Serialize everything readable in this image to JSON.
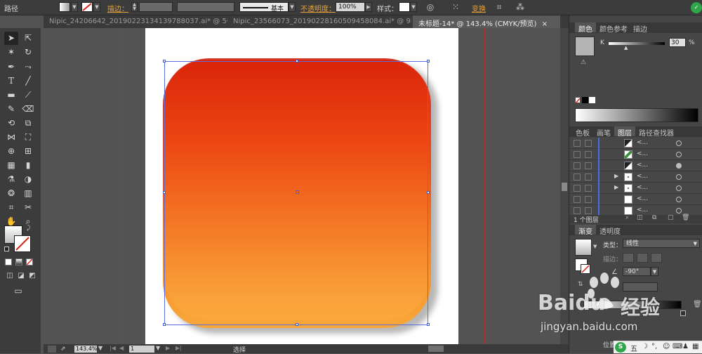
{
  "control_bar": {
    "object_type": "路径",
    "stroke_label": "描边：",
    "stroke_profile": "基本",
    "opacity_label": "不透明度：",
    "opacity_value": "100%",
    "style_label": "样式：",
    "transform_label": "变换",
    "accent_color": "#e8a13a"
  },
  "tabs": [
    {
      "label": "Nipic_24206642_20190223134139788037.ai* @ 50...",
      "active": false
    },
    {
      "label": "Nipic_23566073_20190228160509458084.ai* @ 98...",
      "active": false
    },
    {
      "label": "未标题-14* @ 143.4% (CMYK/预览)",
      "active": true
    }
  ],
  "status_bar": {
    "zoom": "143.4%",
    "artboard_number": "1",
    "tool_name": "选择"
  },
  "color_panel": {
    "tabs": [
      "颜色",
      "颜色参考",
      "描边"
    ],
    "channel_label": "K",
    "channel_value": "30",
    "percent_sign": "%"
  },
  "layers_panel": {
    "tabs": [
      "色板",
      "画笔",
      "图层",
      "路径查找器"
    ],
    "layer_item_label": "<...",
    "rows": [
      {
        "thumb": "diagonal",
        "expand": false,
        "targeted": false
      },
      {
        "thumb": "green",
        "expand": false,
        "targeted": false
      },
      {
        "thumb": "diagonal",
        "expand": false,
        "targeted": true
      },
      {
        "thumb": "dots",
        "expand": true,
        "targeted": false
      },
      {
        "thumb": "dots",
        "expand": true,
        "targeted": false
      },
      {
        "thumb": "white",
        "expand": false,
        "targeted": false
      },
      {
        "thumb": "white",
        "expand": false,
        "targeted": false
      }
    ],
    "footer_label": "1 个图层"
  },
  "gradient_panel": {
    "tabs": [
      "渐变",
      "透明度"
    ],
    "type_label": "类型：",
    "type_value": "线性",
    "stroke_label": "描边：",
    "angle_value": "-90°",
    "location_label": "位置"
  },
  "watermark": {
    "brand": "Baidu",
    "brand_suffix": "经验",
    "url": "jingyan.baidu.com"
  },
  "ime_bar": {
    "mode": "五",
    "logo": "S"
  },
  "gradient_colors": {
    "top": "#d9250a",
    "middle": "#f37323",
    "bottom": "#fba83b"
  }
}
